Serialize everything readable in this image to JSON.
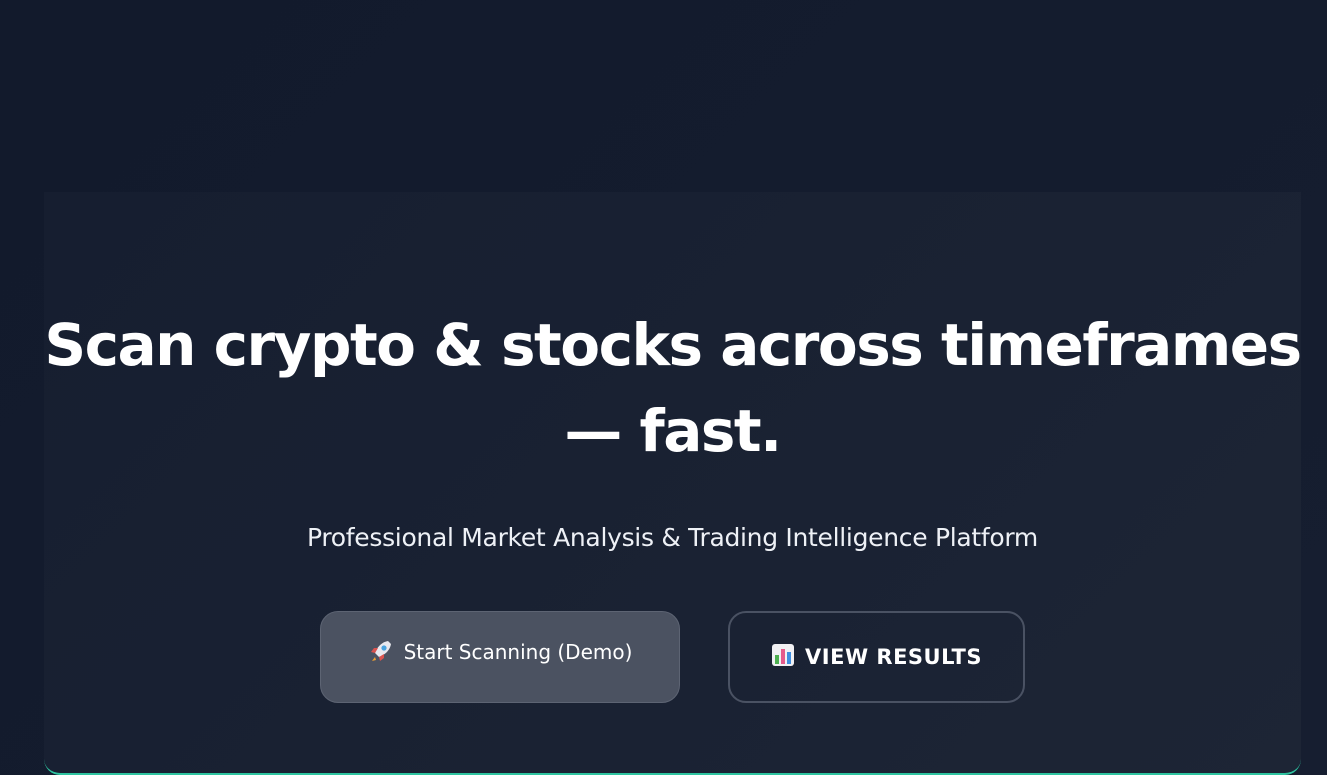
{
  "hero": {
    "title_line1": "Scan crypto & stocks across timeframes",
    "title_line2": "— fast.",
    "subtitle": "Professional Market Analysis & Trading Intelligence Platform"
  },
  "actions": {
    "primary": {
      "label": "Start Scanning (Demo)",
      "icon": "rocket-icon"
    },
    "secondary": {
      "label": "VIEW RESULTS",
      "icon": "bar-chart-icon"
    }
  },
  "colors": {
    "background": "#131a2b",
    "card": "#1a2233",
    "accent": "#2ec4a0",
    "primary_button": "#4b5261",
    "secondary_border": "#4a5263"
  }
}
